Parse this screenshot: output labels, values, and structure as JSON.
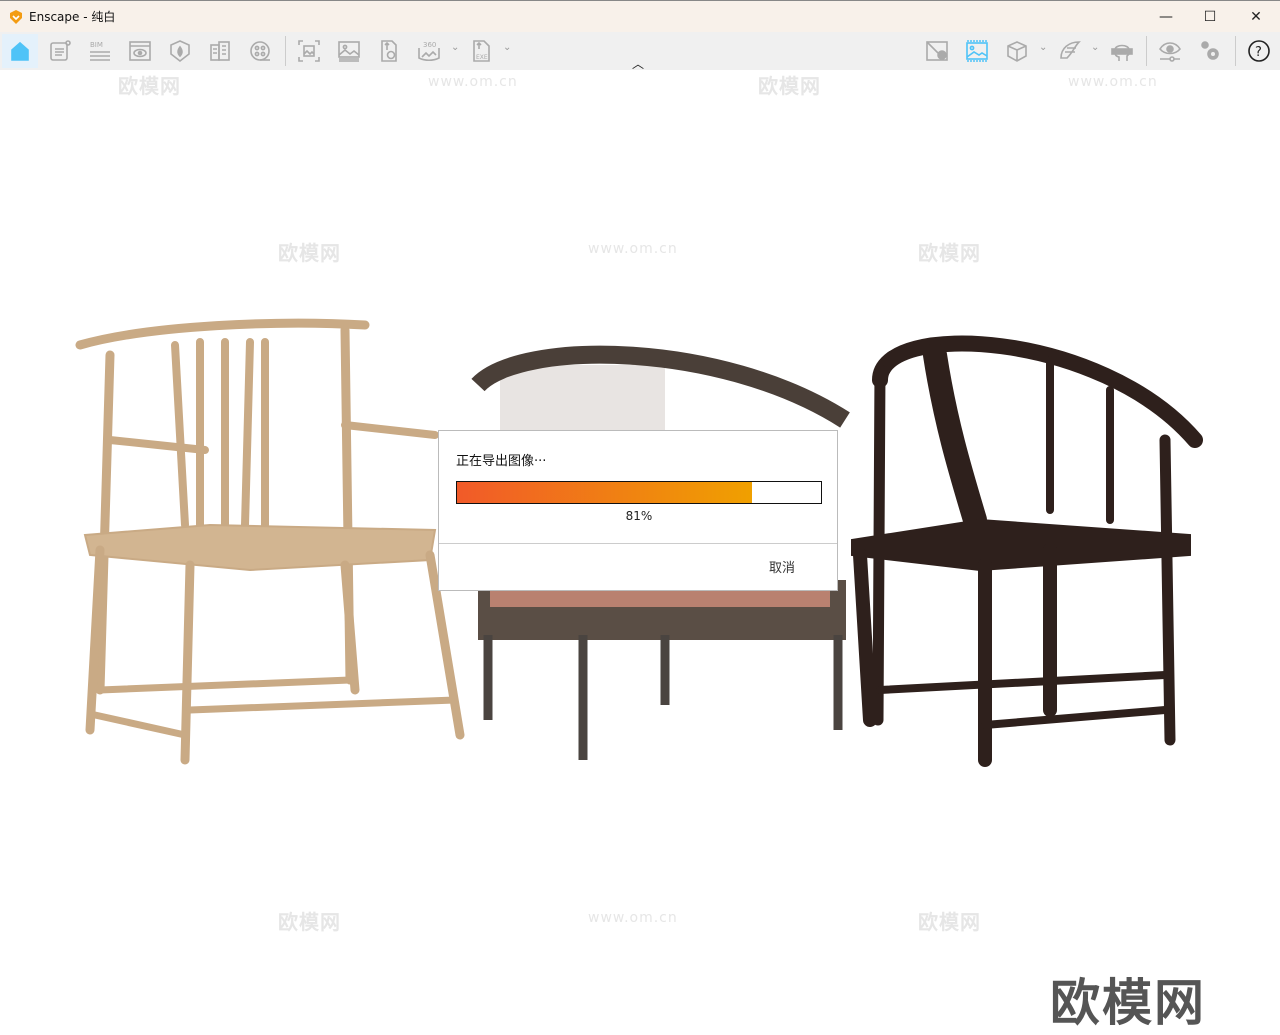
{
  "window": {
    "title": "Enscape - 纯白",
    "minimize": "—",
    "maximize": "☐",
    "close": "✕"
  },
  "toolbar": {
    "left": [
      "home-icon",
      "document-icon",
      "bim-icon",
      "view-window-icon",
      "shield-icon",
      "buildings-icon",
      "film-reel-icon",
      "screenshot-icon",
      "image-icon",
      "file-upload-icon",
      "panorama-360-icon",
      "exe-export-icon"
    ],
    "right": [
      "map-pin-icon",
      "image-render-icon",
      "cube-icon",
      "wings-icon",
      "vr-headset-icon",
      "visual-settings-icon",
      "settings-icon",
      "help-icon"
    ],
    "bim_label": "BIM",
    "pano_label": "360",
    "exe_label": "EXE",
    "help_label": "?"
  },
  "watermarks": {
    "brand": "欧模网",
    "url": "www.om.cn"
  },
  "logo": "欧模网",
  "dialog": {
    "title": "正在导出图像···",
    "progress_percent": 81,
    "progress_label": "81%",
    "cancel": "取消"
  },
  "colors": {
    "accent": "#4fc3f7",
    "progress_start": "#f15a29",
    "progress_end": "#f0a000"
  }
}
